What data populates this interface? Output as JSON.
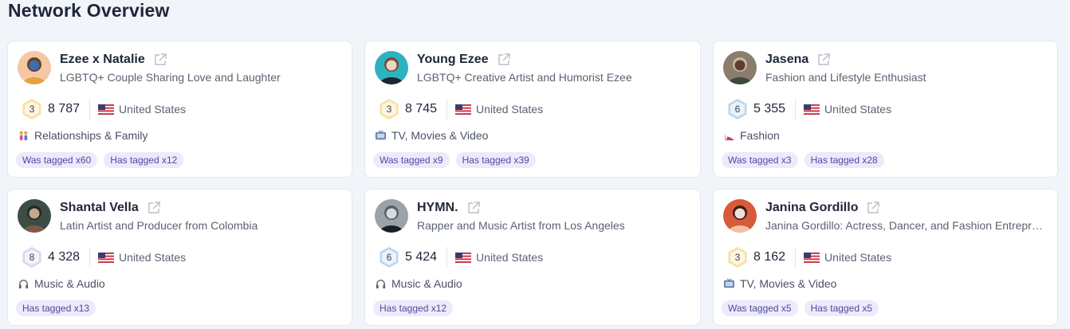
{
  "page": {
    "title": "Network Overview"
  },
  "cards": [
    {
      "name": "Ezee x Natalie",
      "bio": "LGBTQ+ Couple Sharing Love and Laughter",
      "level": "3",
      "level_color": "#f2c94c",
      "followers": "8 787",
      "country": "United States",
      "category": "Relationships & Family",
      "category_icon": "people-holding-hands-icon",
      "tags": [
        "Was tagged x60",
        "Has tagged x12"
      ]
    },
    {
      "name": "Young Ezee",
      "bio": "LGBTQ+ Creative Artist and Humorist Ezee",
      "level": "3",
      "level_color": "#f2c94c",
      "followers": "8 745",
      "country": "United States",
      "category": "TV, Movies & Video",
      "category_icon": "television-icon",
      "tags": [
        "Was tagged x9",
        "Has tagged x39"
      ]
    },
    {
      "name": "Jasena",
      "bio": "Fashion and Lifestyle Enthusiast",
      "level": "6",
      "level_color": "#7fb3e6",
      "followers": "5 355",
      "country": "United States",
      "category": "Fashion",
      "category_icon": "high-heel-icon",
      "tags": [
        "Was tagged x3",
        "Has tagged x28"
      ]
    },
    {
      "name": "Shantal Vella",
      "bio": "Latin Artist and Producer from Colombia",
      "level": "8",
      "level_color": "#b8b6dd",
      "followers": "4 328",
      "country": "United States",
      "category": "Music & Audio",
      "category_icon": "headphones-icon",
      "tags": [
        "Has tagged x13"
      ]
    },
    {
      "name": "HYMN.",
      "bio": "Rapper and Music Artist from Los Angeles",
      "level": "6",
      "level_color": "#7fb3e6",
      "followers": "5 424",
      "country": "United States",
      "category": "Music & Audio",
      "category_icon": "headphones-icon",
      "tags": [
        "Has tagged x12"
      ]
    },
    {
      "name": "Janina Gordillo",
      "bio": "Janina Gordillo: Actress, Dancer, and Fashion Entrepreneur",
      "level": "3",
      "level_color": "#f2c94c",
      "followers": "8 162",
      "country": "United States",
      "category": "TV, Movies & Video",
      "category_icon": "television-icon",
      "tags": [
        "Was tagged x5",
        "Has tagged x5"
      ]
    }
  ]
}
